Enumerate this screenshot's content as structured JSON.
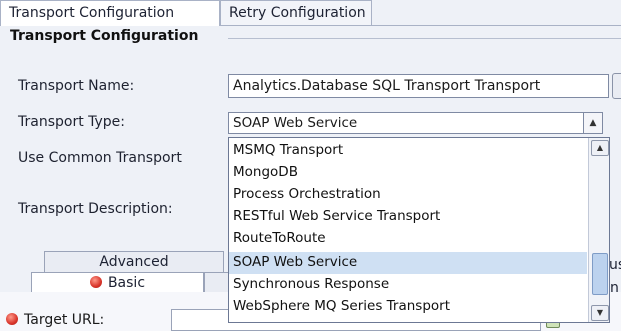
{
  "tabs": [
    {
      "label": "Transport Configuration"
    },
    {
      "label": "Retry Configuration"
    }
  ],
  "section": {
    "title": "Transport Configuration"
  },
  "form": {
    "name_label": "Transport Name:",
    "name_value": "Analytics.Database SQL Transport Transport",
    "type_label": "Transport Type:",
    "type_value": "SOAP Web Service",
    "common_label": "Use Common Transport",
    "description_label": "Transport Description:"
  },
  "dropdown": {
    "options": [
      "MSMQ Transport",
      "MongoDB",
      "Process Orchestration",
      "RESTful Web Service Transport",
      "RouteToRoute",
      "SOAP Web Service",
      "Synchronous Response",
      "WebSphere MQ Series Transport"
    ],
    "selected": "SOAP Web Service"
  },
  "lower_tabs": {
    "advanced": "Advanced",
    "basic": "Basic",
    "edge_1": "us",
    "edge_2": "n"
  },
  "target": {
    "label": "Target URL:"
  },
  "colors": {
    "selected": "#cfe0f3",
    "accent": "#bcd2ee"
  }
}
